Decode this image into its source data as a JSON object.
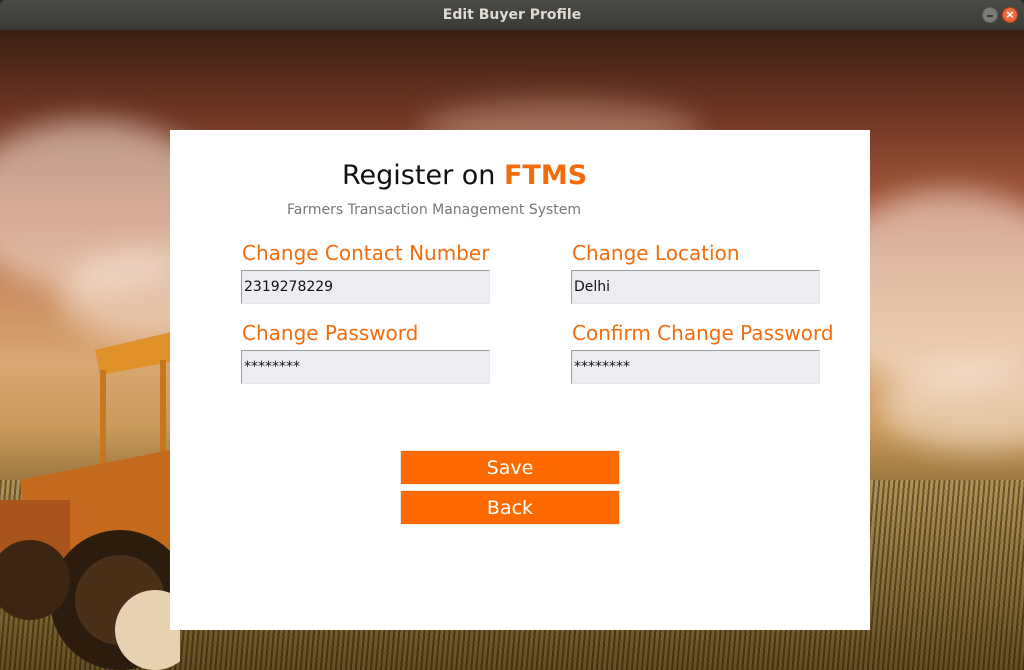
{
  "window": {
    "title": "Edit Buyer Profile",
    "close_glyph": "×"
  },
  "header": {
    "title_prefix": "Register on ",
    "brand": "FTMS",
    "subtitle": "Farmers Transaction Management System"
  },
  "form": {
    "contact": {
      "label": "Change Contact Number",
      "value": "2319278229"
    },
    "location": {
      "label": "Change Location",
      "value": "Delhi"
    },
    "password": {
      "label": "Change Password",
      "value": "********"
    },
    "confirm_password": {
      "label": "Confirm Change Password",
      "value": "********"
    }
  },
  "buttons": {
    "save": "Save",
    "back": "Back"
  },
  "colors": {
    "accent": "#f26c0d",
    "button": "#ff6a00",
    "field_bg": "#ecedf1"
  },
  "icons": {
    "minimize": "minimize-icon",
    "close": "close-icon"
  }
}
